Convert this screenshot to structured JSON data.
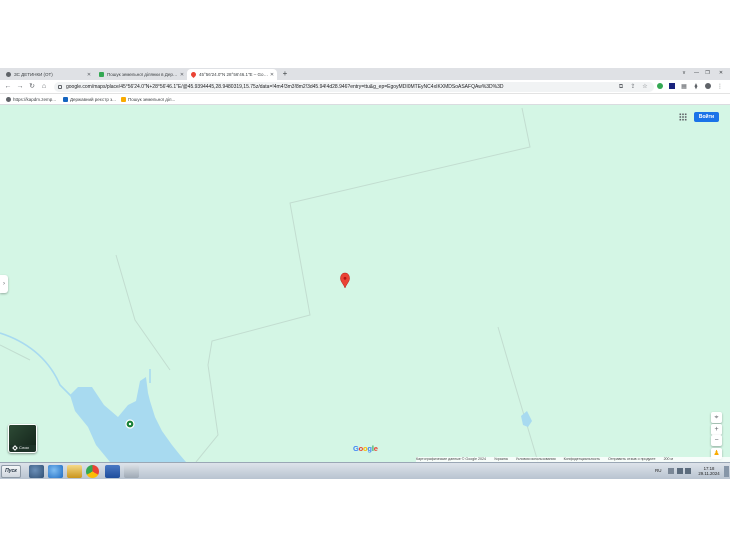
{
  "browser": {
    "tabs": [
      {
        "label": "ЗС ДЕТИНКИ (ОТ)",
        "active": false
      },
      {
        "label": "Пошук земельної ділянки в Держгеокадастрі",
        "active": false
      },
      {
        "label": "45°56'24.0\"N 28°56'46.1\"E – Google Maps",
        "active": true
      }
    ],
    "new_tab": "+",
    "url": "google.com/maps/place/45°56'24.0\"N+28°56'46.1\"E/@45.9394445,28.9480319,15.75z/data=!4m4!3m3!8m2!3d45.94!4d28.946?entry=ttu&g_ep=EgoyMDI0MTEyNC4xIKXMDSoASAFQAw%3D%3D",
    "bookmarks": [
      {
        "label": "https://kapdm.zemp..."
      },
      {
        "label": "Державний реєстр з..."
      },
      {
        "label": "Пошук земельної діл..."
      }
    ],
    "window_controls": [
      "v",
      "—",
      "❐",
      "✕"
    ]
  },
  "map": {
    "signin_label": "Войти",
    "layers_label": "Слои",
    "logo": {
      "g1": "G",
      "o1": "o",
      "o2": "o",
      "g2": "g",
      "l": "l",
      "e": "e"
    },
    "attribution": [
      "Картографические данные © Google 2024",
      "Украина",
      "Условия использования",
      "Конфиденциальность",
      "Отправить отзыв о продукте",
      "200 м"
    ],
    "zoom_in": "+",
    "zoom_out": "−",
    "colors": {
      "land": "#d4f6e5",
      "water": "#a8daf0",
      "pin": "#ea4335",
      "road": "#c5ddd2"
    }
  },
  "taskbar": {
    "start_label": "Пуск",
    "lang": "RU",
    "time": "17:18",
    "date": "29.11.2024"
  }
}
